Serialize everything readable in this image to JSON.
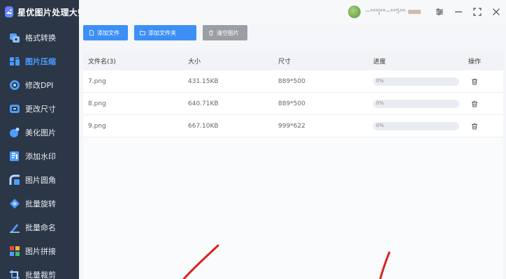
{
  "app": {
    "title": "星优图片处理大师"
  },
  "sidebar": {
    "items": [
      {
        "label": "格式转换",
        "icon": "format-convert-icon",
        "active": false
      },
      {
        "label": "图片压缩",
        "icon": "compress-icon",
        "active": true
      },
      {
        "label": "修改DPI",
        "icon": "dpi-icon",
        "active": false
      },
      {
        "label": "更改尺寸",
        "icon": "resize-icon",
        "active": false
      },
      {
        "label": "美化图片",
        "icon": "beautify-icon",
        "active": false
      },
      {
        "label": "添加水印",
        "icon": "watermark-icon",
        "active": false
      },
      {
        "label": "图片圆角",
        "icon": "round-corner-icon",
        "active": false
      },
      {
        "label": "批量旋转",
        "icon": "rotate-icon",
        "active": false
      },
      {
        "label": "批量命名",
        "icon": "rename-icon",
        "active": false
      },
      {
        "label": "图片拼接",
        "icon": "stitch-icon",
        "active": false
      },
      {
        "label": "批量裁剪",
        "icon": "crop-icon",
        "active": false
      }
    ]
  },
  "titlebar": {
    "username": "~***j**~**5**·",
    "buttons": [
      "settings-icon",
      "minimize-icon",
      "maximize-icon",
      "close-icon"
    ]
  },
  "toolbar": {
    "add_file": "添加文件",
    "add_folder": "添加文件夹",
    "clear_images": "清空图片"
  },
  "table": {
    "headers": {
      "name": "文件名(3)",
      "size": "大小",
      "dimensions": "尺寸",
      "progress": "进度",
      "actions": "操作"
    },
    "rows": [
      {
        "name": "7.png",
        "size": "431.15KB",
        "dimensions": "889*500",
        "progress": "0%",
        "progress_value": 0
      },
      {
        "name": "8.png",
        "size": "640.71KB",
        "dimensions": "889*500",
        "progress": "0%",
        "progress_value": 0
      },
      {
        "name": "9.png",
        "size": "667.10KB",
        "dimensions": "999*622",
        "progress": "0%",
        "progress_value": 0
      }
    ]
  },
  "colors": {
    "sidebar_bg": "#2b3646",
    "accent": "#3d8ff5",
    "active_text": "#4b9cff",
    "clear_button": "#9a9ea5",
    "annotation_arrow": "#d9221c"
  }
}
